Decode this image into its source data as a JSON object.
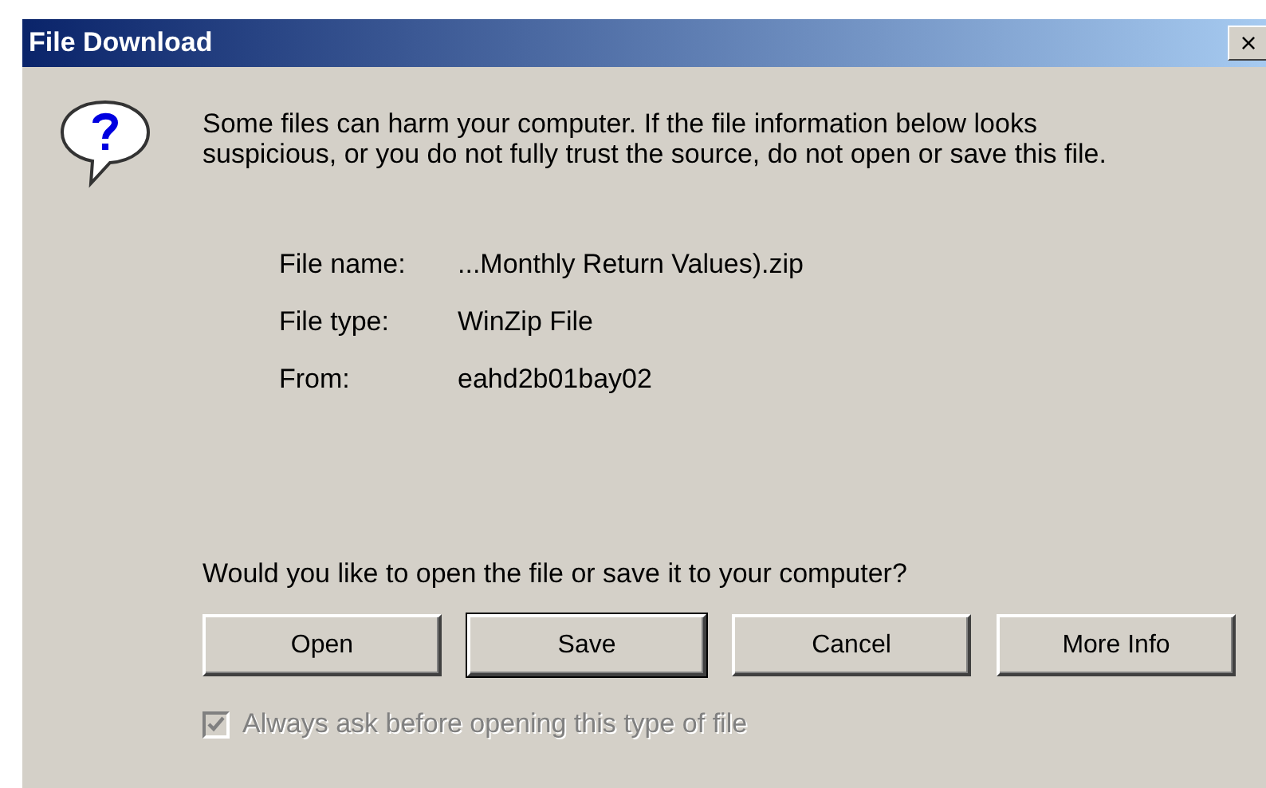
{
  "window": {
    "title": "File Download",
    "close": "×"
  },
  "message": "Some files can harm your computer. If the file information below looks suspicious, or you do not fully trust the source, do not open or save this file.",
  "details": [
    {
      "label": "File name:",
      "value": "...Monthly Return Values).zip"
    },
    {
      "label": "File type:",
      "value": "WinZip File"
    },
    {
      "label": "From:",
      "value": "eahd2b01bay02"
    }
  ],
  "question": "Would you like to open the file or save it to your computer?",
  "buttons": [
    {
      "label": "Open",
      "default": false
    },
    {
      "label": "Save",
      "default": true
    },
    {
      "label": "Cancel",
      "default": false
    },
    {
      "label": "More Info",
      "default": false
    }
  ],
  "checkbox": {
    "label": "Always ask before opening this type of file",
    "checked": true,
    "disabled": true
  }
}
